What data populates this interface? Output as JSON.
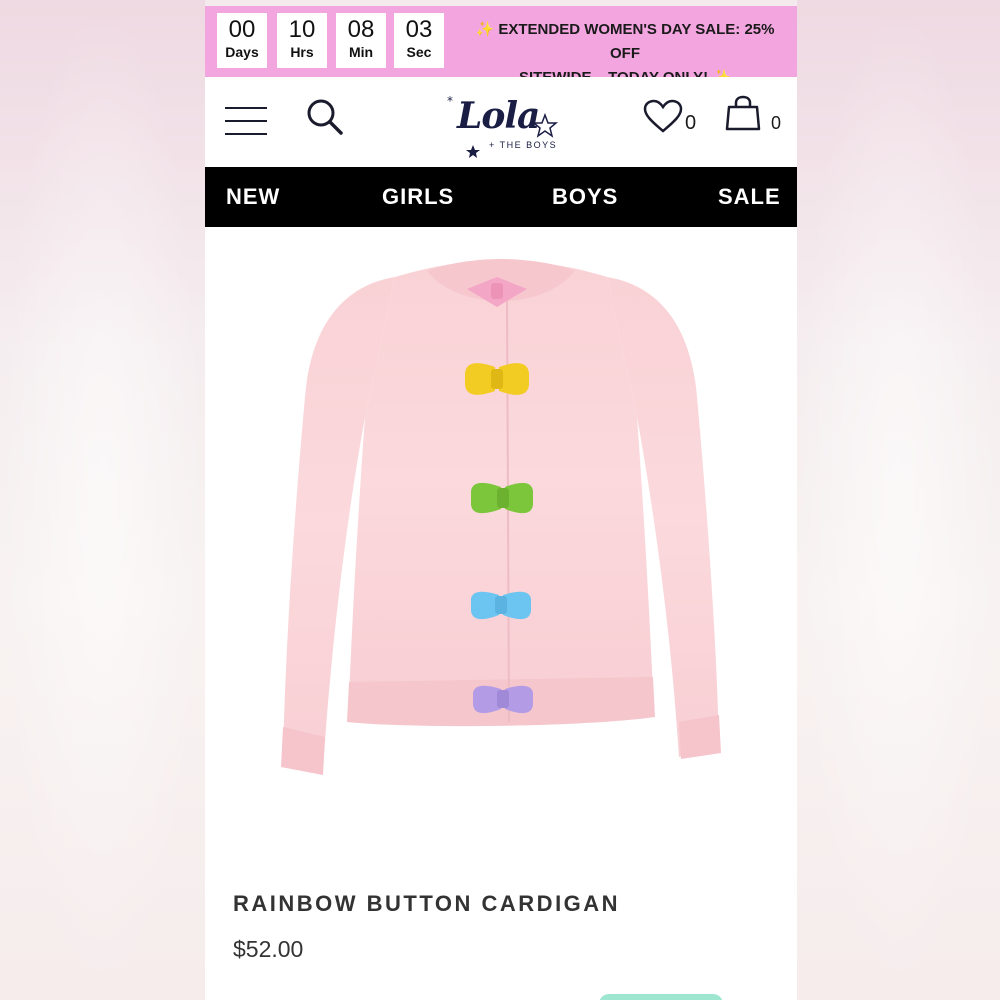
{
  "countdown": [
    {
      "value": "00",
      "unit": "Days"
    },
    {
      "value": "10",
      "unit": "Hrs"
    },
    {
      "value": "08",
      "unit": "Min"
    },
    {
      "value": "03",
      "unit": "Sec"
    }
  ],
  "promo": {
    "line1": "EXTENDED WOMEN'S DAY SALE: 25% OFF",
    "line2": "SITEWIDE – TODAY ONLY!",
    "sparkle": "✨"
  },
  "header": {
    "logo_word": "Lola",
    "logo_sub": "+ THE BOYS",
    "wishlist_count": "0",
    "cart_count": "0"
  },
  "nav": [
    "NEW",
    "GIRLS",
    "BOYS",
    "SALE"
  ],
  "product": {
    "title": "RAINBOW BUTTON CARDIGAN",
    "price": "$52.00",
    "bow_colors": [
      "#f4a6c6",
      "#f2cc22",
      "#7cc63c",
      "#6cc4f0",
      "#b49be6"
    ]
  },
  "colors": {
    "promo_bg": "#f2a5df",
    "nav_bg": "#000000",
    "brand_navy": "#1a1d44"
  }
}
